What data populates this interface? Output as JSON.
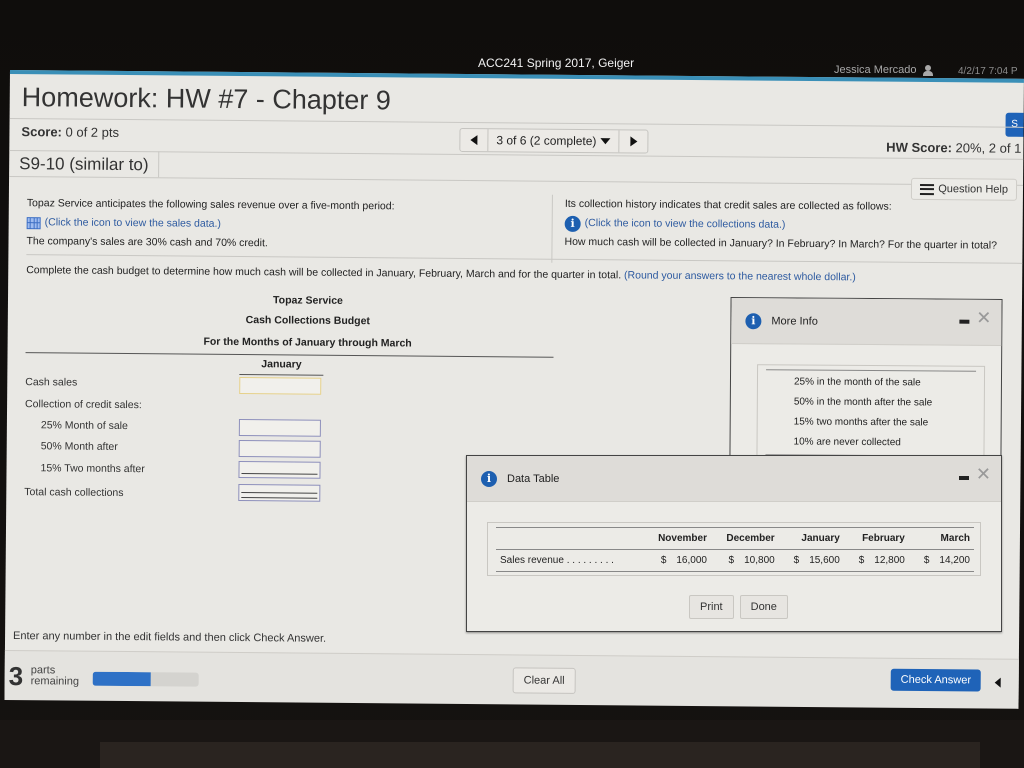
{
  "topbar": {
    "course": "ACC241 Spring 2017, Geiger",
    "user": "Jessica Mercado",
    "datetime": "4/2/17 7:04 P"
  },
  "header": {
    "title": "Homework: HW #7 - Chapter 9",
    "save_label": "S",
    "score_label": "Score:",
    "score_value": "0 of 2 pts",
    "nav_text": "3 of 6 (2 complete)",
    "hw_score_label": "HW Score:",
    "hw_score_value": "20%, 2 of 1",
    "problem_id": "S9-10 (similar to)",
    "question_help": "Question Help"
  },
  "problem": {
    "left": {
      "line1": "Topaz Service anticipates the following sales revenue over a five-month period:",
      "link": "(Click the icon to view the sales data.)",
      "line3": "The company's sales are 30% cash and 70% credit."
    },
    "right": {
      "line1": "Its collection history indicates that credit sales are collected as follows:",
      "link": "(Click the icon to view the collections data.)",
      "line3": "How much cash will be collected in January? In February? In March? For the quarter in total?"
    },
    "instruction": "Complete the cash budget to determine how much cash will be collected in January, February, March and for the quarter in total.",
    "instruction_round": "(Round your answers to the nearest whole dollar.)"
  },
  "budget": {
    "company": "Topaz Service",
    "title": "Cash Collections Budget",
    "period": "For the Months of January through March",
    "column": "January",
    "rows": [
      {
        "label": "Cash sales",
        "value": ""
      },
      {
        "label": "Collection of credit sales:"
      },
      {
        "label": "25% Month of sale",
        "value": ""
      },
      {
        "label": "50% Month after",
        "value": ""
      },
      {
        "label": "15% Two months after",
        "value": ""
      },
      {
        "label": "Total cash collections",
        "value": ""
      }
    ]
  },
  "more_info": {
    "title": "More Info",
    "items": [
      "25% in the month of the sale",
      "50% in the month after the sale",
      "15% two months after the sale",
      "10% are never collected"
    ]
  },
  "data_table": {
    "title": "Data Table",
    "columns": [
      "November",
      "December",
      "January",
      "February",
      "March"
    ],
    "row_label": "Sales revenue . . . . . . . . .",
    "currency": "$",
    "values": [
      "16,000",
      "10,800",
      "15,600",
      "12,800",
      "14,200"
    ],
    "print_label": "Print",
    "done_label": "Done"
  },
  "footer": {
    "hint": "Enter any number in the edit fields and then click Check Answer.",
    "parts_count": "3",
    "parts_line1": "parts",
    "parts_line2": "remaining",
    "progress_fraction": 0.55,
    "clear_all": "Clear All",
    "check_answer": "Check Answer"
  }
}
